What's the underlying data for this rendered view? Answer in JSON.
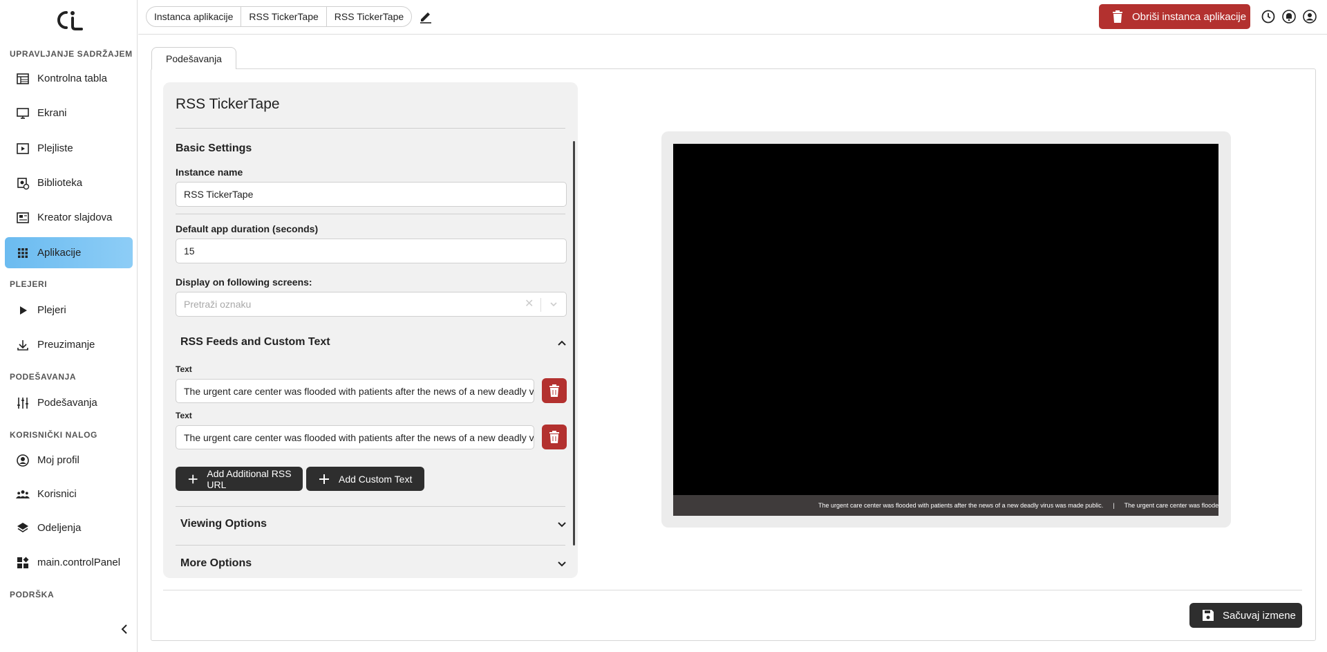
{
  "sidebar": {
    "sections": {
      "content": "UPRAVLJANJE SADRŽAJEM",
      "players": "PLEJERI",
      "settings": "PODEŠAVANJA",
      "account": "KORISNIČKI NALOG",
      "support": "PODRŠKA"
    },
    "items": [
      {
        "label": "Kontrolna tabla",
        "icon": "dashboard-icon"
      },
      {
        "label": "Ekrani",
        "icon": "monitor-icon"
      },
      {
        "label": "Plejliste",
        "icon": "playlist-icon"
      },
      {
        "label": "Biblioteka",
        "icon": "library-icon"
      },
      {
        "label": "Kreator slajdova",
        "icon": "slide-creator-icon"
      },
      {
        "label": "Aplikacije",
        "icon": "apps-grid-icon",
        "active": true
      },
      {
        "label": "Plejeri",
        "icon": "play-icon"
      },
      {
        "label": "Preuzimanje",
        "icon": "download-icon"
      },
      {
        "label": "Podešavanja",
        "icon": "sliders-icon"
      },
      {
        "label": "Moj profil",
        "icon": "user-circle-icon"
      },
      {
        "label": "Korisnici",
        "icon": "users-icon"
      },
      {
        "label": "Odeljenja",
        "icon": "layers-icon"
      },
      {
        "label": "main.controlPanel",
        "icon": "widgets-icon"
      }
    ]
  },
  "topbar": {
    "breadcrumb": [
      "Instanca aplikacije",
      "RSS TickerTape",
      "RSS TickerTape"
    ],
    "delete_label": "Obriši instanca aplikacije"
  },
  "tab": {
    "label": "Podešavanja"
  },
  "card": {
    "title": "RSS TickerTape",
    "basic_settings": "Basic Settings",
    "instance_name_label": "Instance name",
    "instance_name_value": "RSS TickerTape",
    "duration_label": "Default app duration (seconds)",
    "duration_value": "15",
    "screens_label": "Display on following screens:",
    "screens_placeholder": "Pretraži oznaku",
    "rss_section": "RSS Feeds and Custom Text",
    "text_label": "Text",
    "text_items": [
      "The urgent care center was flooded with patients after the news of a new deadly virus was made public.",
      "The urgent care center was flooded with patients after the news of a new deadly virus was made public."
    ],
    "add_rss_label": "Add Additional RSS URL",
    "add_text_label": "Add Custom Text",
    "viewing_options": "Viewing Options",
    "more_options": "More Options"
  },
  "preview": {
    "ticker_text": "The urgent care center was flooded with patients after the news of a new deadly virus was made public.",
    "ticker_separator": "|",
    "ticker_text_2": "The urgent care center was flooded with patients after the news of a new deadly virus was made public."
  },
  "save_label": "Sačuvaj izmene",
  "colors": {
    "accent_active": "#7cc4f0",
    "danger": "#b3312f",
    "dark_button": "#2e2e2e"
  }
}
